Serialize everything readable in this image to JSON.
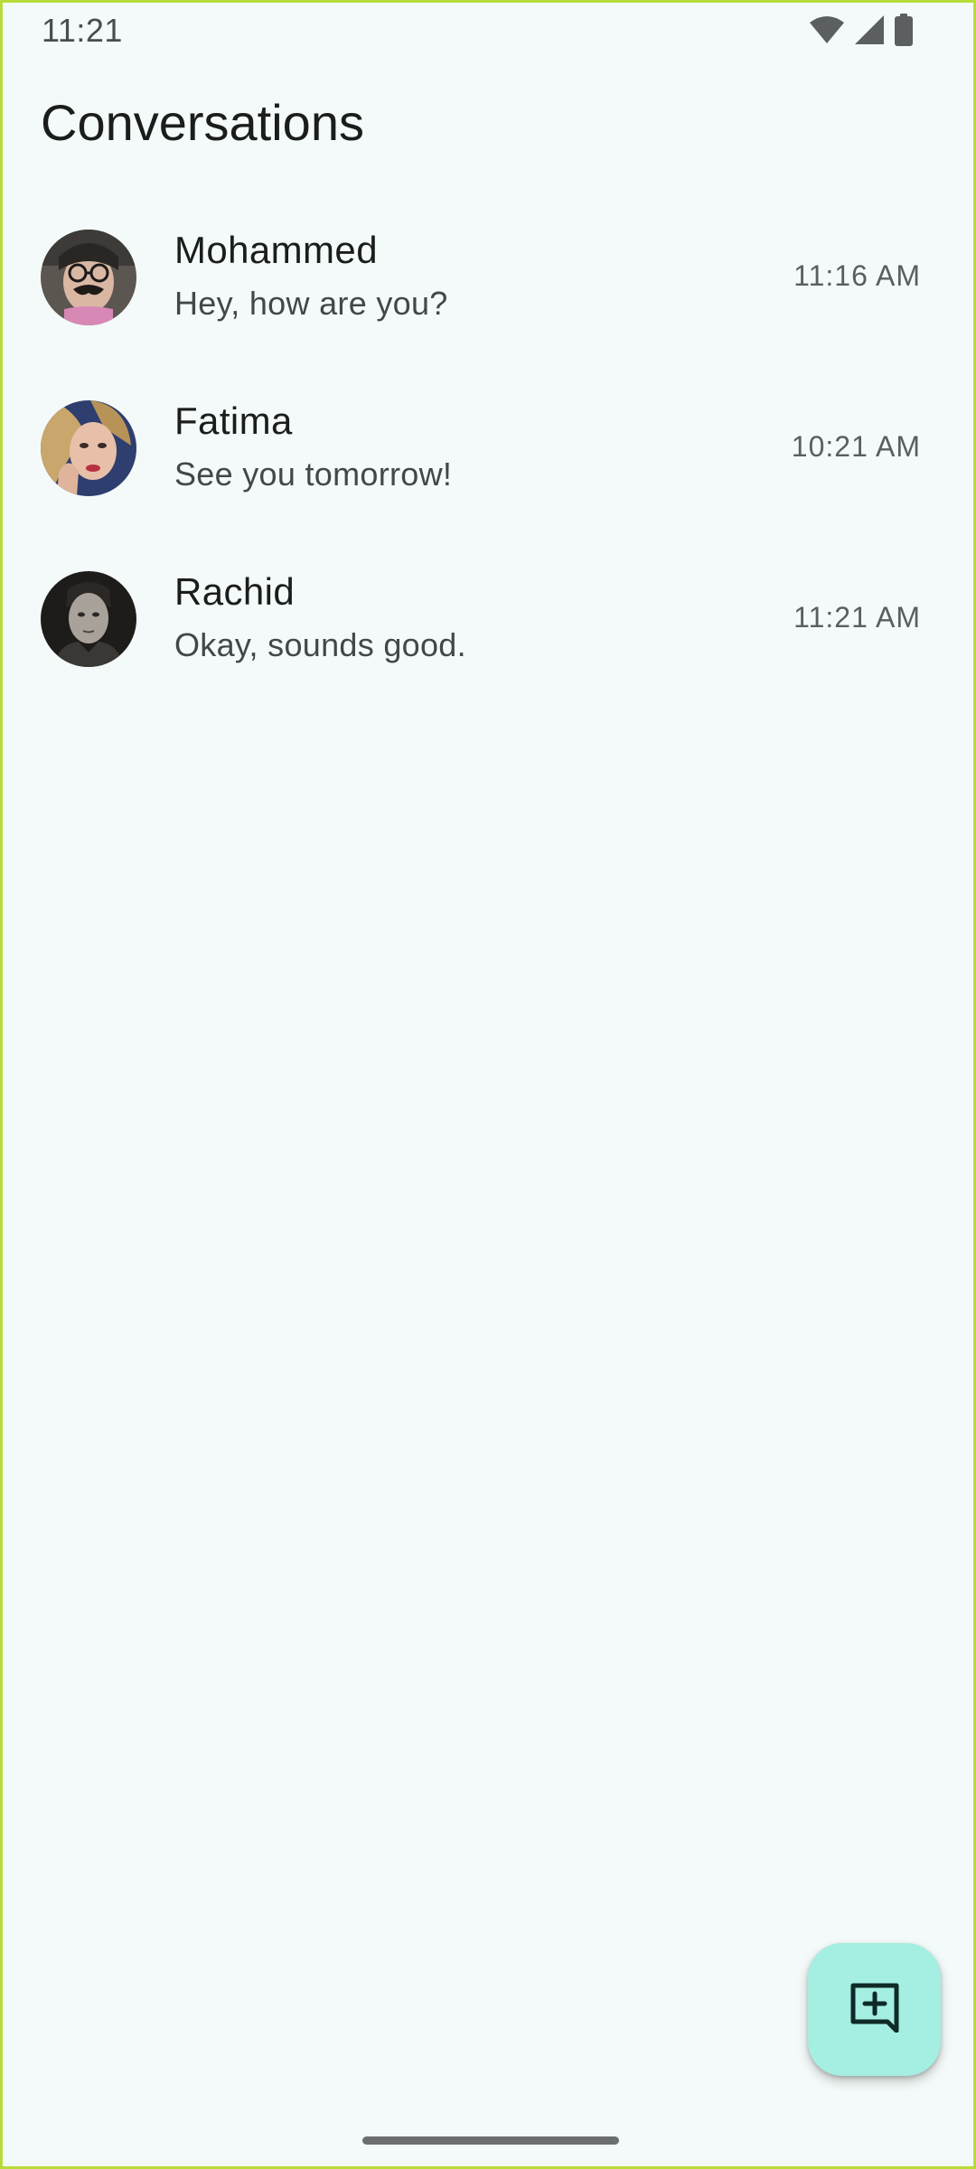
{
  "status_bar": {
    "time": "11:21",
    "icons": [
      "wifi-icon",
      "cellular-signal-icon",
      "battery-icon"
    ]
  },
  "header": {
    "title": "Conversations"
  },
  "conversations": [
    {
      "name": "Mohammed",
      "last_message": "Hey, how are you?",
      "time": "11:16 AM",
      "avatar": "avatar-photo-disguise"
    },
    {
      "name": "Fatima",
      "last_message": "See you tomorrow!",
      "time": "10:21 AM",
      "avatar": "avatar-photo-woman"
    },
    {
      "name": "Rachid",
      "last_message": "Okay, sounds good.",
      "time": "11:21 AM",
      "avatar": "avatar-photo-man"
    }
  ],
  "fab": {
    "icon": "new-chat-icon"
  },
  "colors": {
    "background": "#f4faf9",
    "fab": "#a5eee2",
    "frame_border": "#b7dc3a"
  }
}
